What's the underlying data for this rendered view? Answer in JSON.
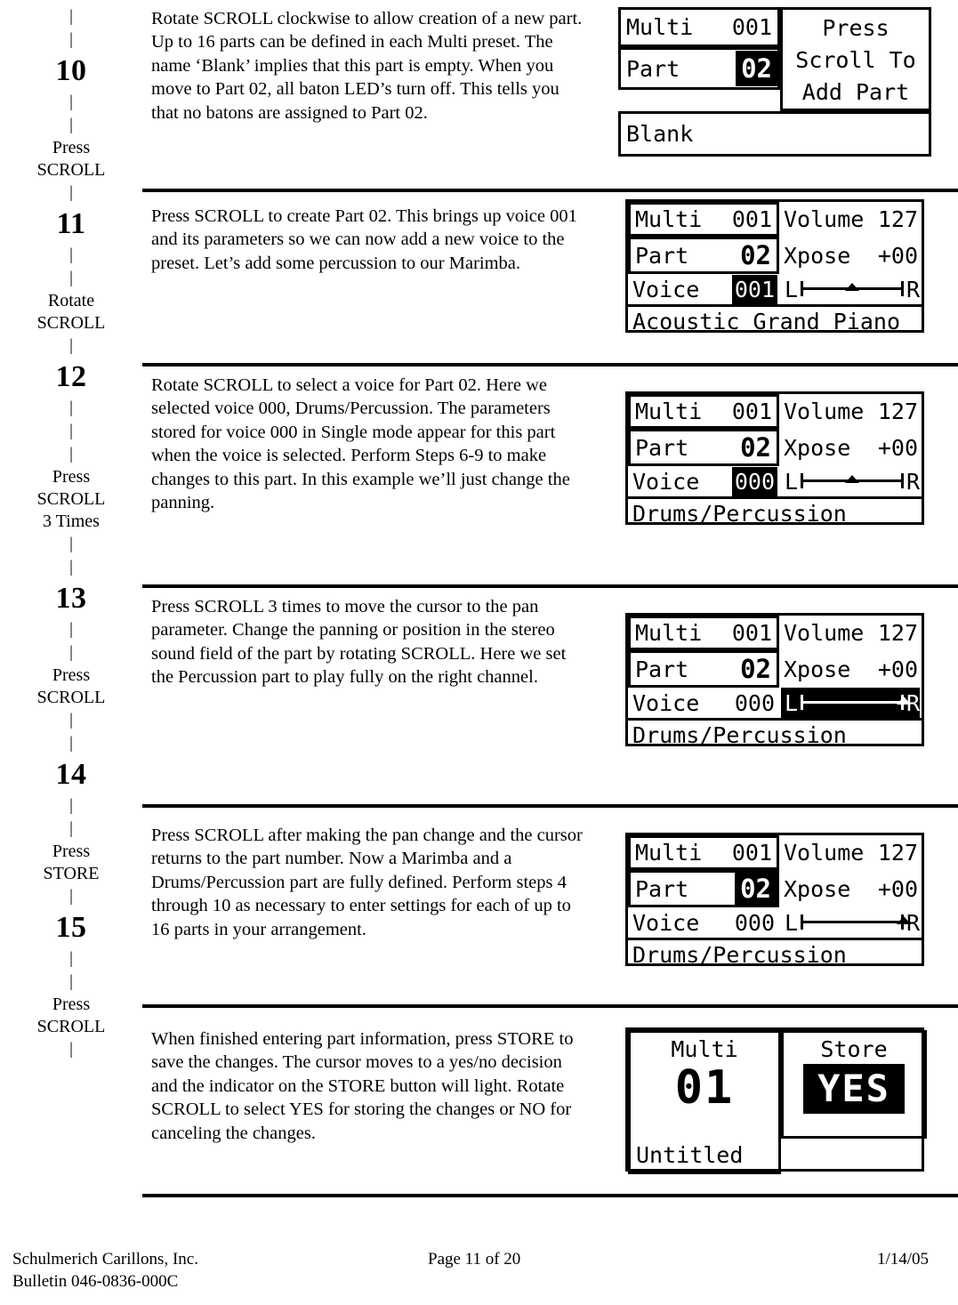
{
  "rail": {
    "items": [
      {
        "type": "pipe",
        "text": "|"
      },
      {
        "type": "pipe",
        "text": "|"
      },
      {
        "type": "num",
        "text": "10"
      },
      {
        "type": "pipe",
        "text": "|"
      },
      {
        "type": "pipe",
        "text": "|"
      },
      {
        "type": "label",
        "text": "Press"
      },
      {
        "type": "label",
        "text": "SCROLL"
      },
      {
        "type": "pipe",
        "text": "|"
      },
      {
        "type": "num",
        "text": "11"
      },
      {
        "type": "pipe",
        "text": "|"
      },
      {
        "type": "pipe",
        "text": "|"
      },
      {
        "type": "label",
        "text": "Rotate"
      },
      {
        "type": "label",
        "text": "SCROLL"
      },
      {
        "type": "pipe",
        "text": "|"
      },
      {
        "type": "num",
        "text": "12"
      },
      {
        "type": "pipe",
        "text": "|"
      },
      {
        "type": "pipe",
        "text": "|"
      },
      {
        "type": "pipe",
        "text": "|"
      },
      {
        "type": "label",
        "text": "Press"
      },
      {
        "type": "label",
        "text": "SCROLL"
      },
      {
        "type": "label",
        "text": "3 Times"
      },
      {
        "type": "pipe",
        "text": "|"
      },
      {
        "type": "pipe",
        "text": "|"
      },
      {
        "type": "num",
        "text": "13"
      },
      {
        "type": "pipe",
        "text": "|"
      },
      {
        "type": "pipe",
        "text": "|"
      },
      {
        "type": "label",
        "text": "Press"
      },
      {
        "type": "label",
        "text": "SCROLL"
      },
      {
        "type": "pipe",
        "text": "|"
      },
      {
        "type": "pipe",
        "text": "|"
      },
      {
        "type": "num",
        "text": "14"
      },
      {
        "type": "pipe",
        "text": "|"
      },
      {
        "type": "pipe",
        "text": "|"
      },
      {
        "type": "label",
        "text": "Press"
      },
      {
        "type": "label",
        "text": "STORE"
      },
      {
        "type": "pipe",
        "text": "|"
      },
      {
        "type": "num",
        "text": "15"
      },
      {
        "type": "pipe",
        "text": "|"
      },
      {
        "type": "pipe",
        "text": "|"
      },
      {
        "type": "label",
        "text": "Press"
      },
      {
        "type": "label",
        "text": "SCROLL"
      },
      {
        "type": "pipe",
        "text": "|"
      }
    ]
  },
  "steps": [
    {
      "id": "step-10",
      "description": "Rotate SCROLL clockwise to allow creation of a new part.  Up to 16 parts can be defined in each Multi preset.  The name ‘Blank’ implies that this part is empty. When you move to Part 02, all baton LED’s turn off. This tells you that no batons are assigned to Part 02.",
      "screen": {
        "kind": "add-part",
        "multi_label": "Multi",
        "multi_value": "001",
        "part_label": "Part",
        "part_value": "02",
        "part_value_inverted": true,
        "prompt_line1": "Press",
        "prompt_line2": "Scroll To",
        "prompt_line3": "Add Part",
        "name": "Blank"
      }
    },
    {
      "id": "step-11",
      "description": "Press SCROLL to create Part 02.  This brings up voice 001 and its parameters so we can now add a new voice to the preset.  Let’s add some percussion to our Marimba.",
      "screen": {
        "kind": "param",
        "multi_label": "Multi",
        "multi_value": "001",
        "part_label": "Part",
        "part_value": "02",
        "part_value_inverted": false,
        "voice_label": "Voice",
        "voice_value": "001",
        "voice_value_inverted": true,
        "volume_label": "Volume",
        "volume_value": "127",
        "xpose_label": "Xpose",
        "xpose_value": "+00",
        "pan_left_label": "L",
        "pan_right_label": "R",
        "pan_position_pct": 50,
        "pan_inverted": false,
        "name": "Acoustic Grand Piano"
      }
    },
    {
      "id": "step-12",
      "description": "Rotate SCROLL to select a voice for Part 02. Here we selected voice 000, Drums/Percussion.  The parameters stored for voice 000 in Single mode appear for this part when the voice is selected.  Perform Steps 6-9 to make changes to this part.  In this example we’ll just change the panning.",
      "screen": {
        "kind": "param",
        "multi_label": "Multi",
        "multi_value": "001",
        "part_label": "Part",
        "part_value": "02",
        "part_value_inverted": false,
        "voice_label": "Voice",
        "voice_value": "000",
        "voice_value_inverted": true,
        "volume_label": "Volume",
        "volume_value": "127",
        "xpose_label": "Xpose",
        "xpose_value": "+00",
        "pan_left_label": "L",
        "pan_right_label": "R",
        "pan_position_pct": 50,
        "pan_inverted": false,
        "name": "Drums/Percussion"
      }
    },
    {
      "id": "step-13",
      "description": "Press SCROLL 3 times to move the cursor to the pan parameter. Change the panning or position in the stereo sound field of the part by rotating SCROLL.  Here we set the Percussion part to play fully on the right channel.",
      "screen": {
        "kind": "param",
        "multi_label": "Multi",
        "multi_value": "001",
        "part_label": "Part",
        "part_value": "02",
        "part_value_inverted": false,
        "voice_label": "Voice",
        "voice_value": "000",
        "voice_value_inverted": false,
        "volume_label": "Volume",
        "volume_value": "127",
        "xpose_label": "Xpose",
        "xpose_value": "+00",
        "pan_left_label": "L",
        "pan_right_label": "R",
        "pan_position_pct": 100,
        "pan_inverted": true,
        "name": "Drums/Percussion"
      }
    },
    {
      "id": "step-14",
      "description": "Press SCROLL after making the pan change and the cursor returns to the part number. Now a Marimba and a Drums/Percussion part are fully defined.  Perform steps 4 through 10 as necessary to enter settings for each of up to 16 parts in your arrangement.",
      "screen": {
        "kind": "param",
        "multi_label": "Multi",
        "multi_value": "001",
        "part_label": "Part",
        "part_value": "02",
        "part_value_inverted": true,
        "voice_label": "Voice",
        "voice_value": "000",
        "voice_value_inverted": false,
        "volume_label": "Volume",
        "volume_value": "127",
        "xpose_label": "Xpose",
        "xpose_value": "+00",
        "pan_left_label": "L",
        "pan_right_label": "R",
        "pan_position_pct": 100,
        "pan_inverted": false,
        "name": "Drums/Percussion"
      }
    },
    {
      "id": "step-15",
      "description": "When finished entering part information, press STORE to save the changes. The cursor moves to a yes/no decision and the indicator on the STORE button will light.  Rotate SCROLL to select YES for storing the changes or NO for canceling the changes.",
      "screen": {
        "kind": "store",
        "multi_label": "Multi",
        "multi_value": "01",
        "store_label": "Store",
        "store_choice": "YES",
        "store_choice_inverted": true,
        "name": "Untitled"
      }
    }
  ],
  "footer": {
    "company": "Schulmerich Carillons, Inc.",
    "bulletin": "Bulletin 046-0836-000C",
    "page": "Page 11 of 20",
    "date": "1/14/05"
  }
}
